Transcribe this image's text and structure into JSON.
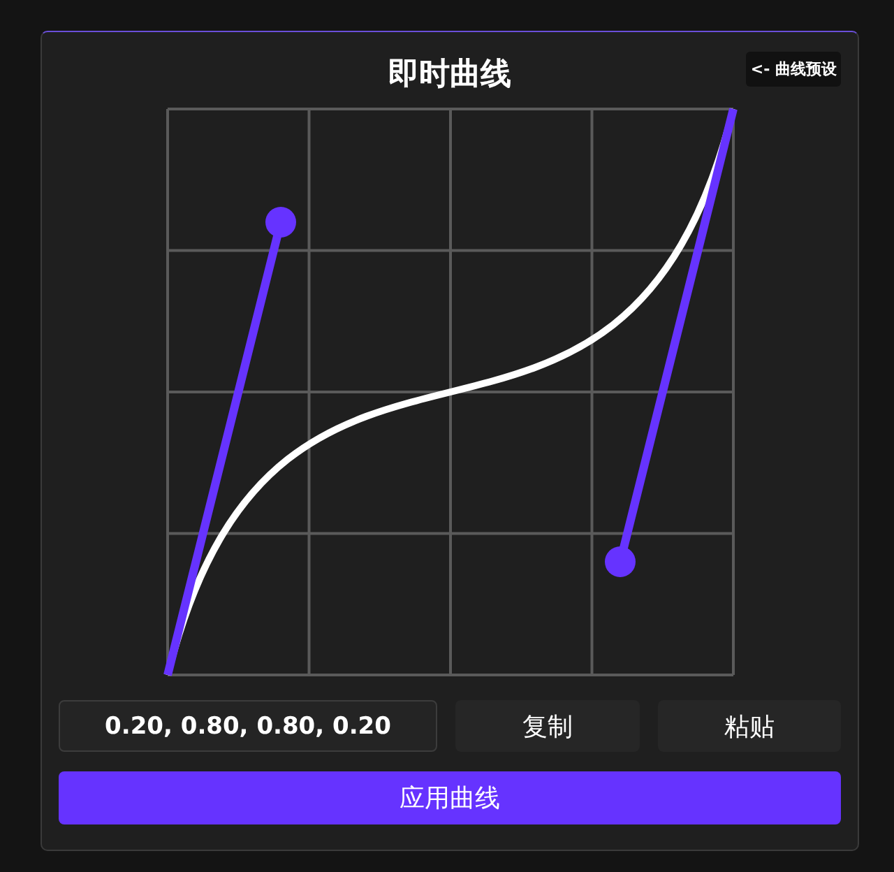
{
  "panel": {
    "title": "即时曲线",
    "preset_button": "<- 曲线预设"
  },
  "curve_value": {
    "value": "0.20, 0.80, 0.80, 0.20"
  },
  "buttons": [
    {
      "label": "复制"
    },
    {
      "label": "粘贴"
    }
  ],
  "apply_button": {
    "label": "应用曲线"
  }
}
